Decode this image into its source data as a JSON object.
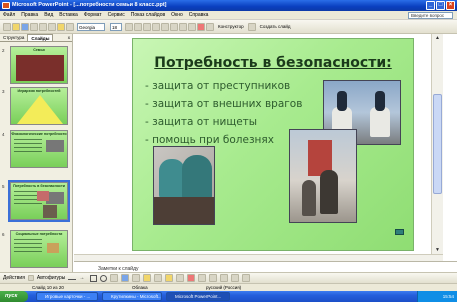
{
  "window": {
    "title": "Microsoft PowerPoint - [...потребности семьи 8 класс.ppt]"
  },
  "menu": [
    "Файл",
    "Правка",
    "Вид",
    "Вставка",
    "Формат",
    "Сервис",
    "Показ слайдов",
    "Окно",
    "Справка"
  ],
  "help_box": "Введите вопрос",
  "toolbar": {
    "font": "Georgia",
    "size": "18",
    "konstruktor": "Конструктор",
    "create_slide": "Создать слайд"
  },
  "left_panel": {
    "tabs": [
      "Структура",
      "Слайды"
    ],
    "close": "x"
  },
  "thumbnails": [
    {
      "num": "2",
      "title": "Семья"
    },
    {
      "num": "3",
      "title": "Иерархия потребностей"
    },
    {
      "num": "4",
      "title": "Физиологические потребности"
    },
    {
      "num": "5",
      "title": "Потребность в безопасности"
    },
    {
      "num": "6",
      "title": "Социальные потребности"
    }
  ],
  "slide": {
    "title": "Потребность в безопасности:",
    "bullets": [
      "-  защита от преступников",
      "-  защита от внешних врагов",
      "-  защита от нищеты",
      "-  помощь при болезнях"
    ]
  },
  "notes": {
    "placeholder": "Заметки к слайду"
  },
  "drawbar": {
    "actions": "Действия",
    "autoshapes": "Автофигуры"
  },
  "status": {
    "slide": "Слайд 10 из 20",
    "design": "Облака",
    "lang": "русский (Россия)"
  },
  "taskbar": {
    "start": "пуск",
    "tasks": [
      "Игровые карточки - ...",
      "Крутилкины - Microsoft...",
      "Microsoft PowerPoint..."
    ],
    "clock": "15:54"
  }
}
